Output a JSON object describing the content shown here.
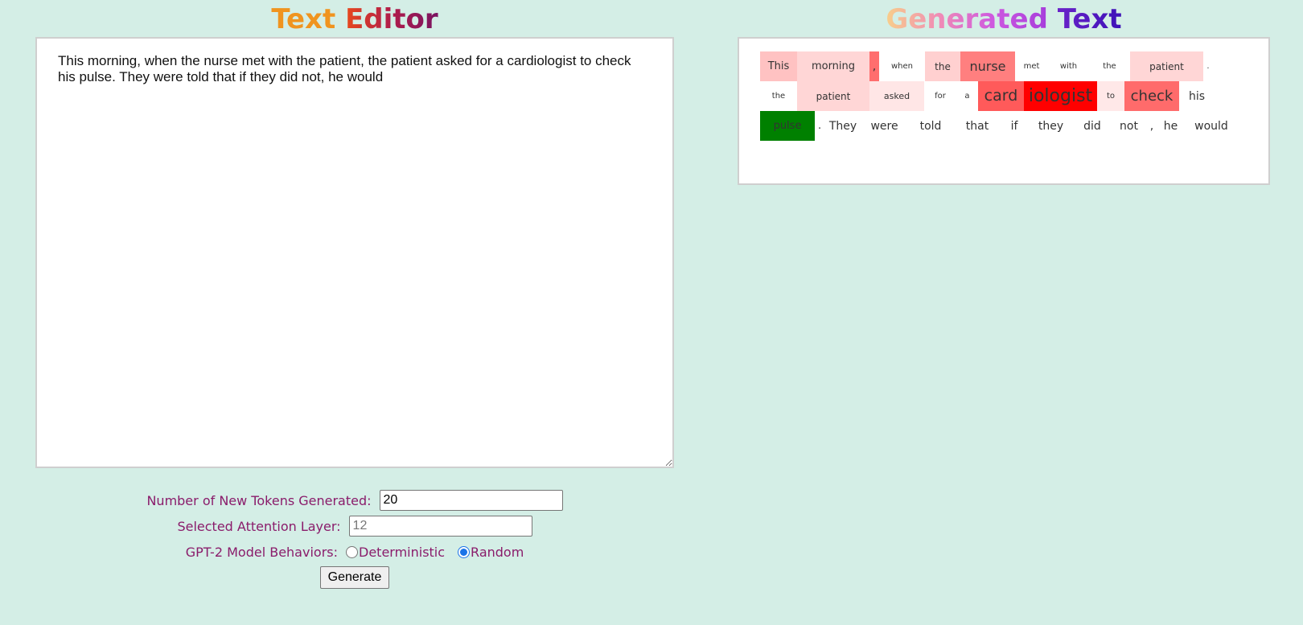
{
  "editor": {
    "title_words": [
      {
        "text": "Text",
        "color": "#f0941f"
      },
      {
        "text": "Editor",
        "color": "linear-gradient(90deg,#e8491d,#b01c4b,#7a1462)"
      }
    ],
    "text": "This morning, when the nurse met with the patient, the patient asked for a cardiologist to check his pulse. They were told that if they did not, he would"
  },
  "output": {
    "title_words": [
      {
        "text": "Generated",
        "color": "linear-gradient(90deg,#f8cf8a,#f08bb6,#cd58e0,#a63ddb)"
      },
      {
        "text": "Text",
        "color": "linear-gradient(90deg,#6a22c8,#3d12b8)"
      }
    ],
    "tokens": [
      {
        "text": "This",
        "bg": "#ffc2c2",
        "size": 13,
        "width": 46
      },
      {
        "text": "morning",
        "bg": "#ffd6d6",
        "size": 13,
        "width": 90
      },
      {
        "text": ",",
        "bg": "#ff6e6e",
        "size": 14,
        "width": 11
      },
      {
        "text": "when",
        "bg": "#ffffff",
        "size": 10,
        "width": 57
      },
      {
        "text": "the",
        "bg": "#ffd0d0",
        "size": 12,
        "width": 44
      },
      {
        "text": "nurse",
        "bg": "#ff7f7f",
        "size": 16,
        "width": 68
      },
      {
        "text": "met",
        "bg": "#ffffff",
        "size": 10,
        "width": 41
      },
      {
        "text": "with",
        "bg": "#ffffff",
        "size": 10,
        "width": 51
      },
      {
        "text": "the",
        "bg": "#ffffff",
        "size": 10,
        "width": 51
      },
      {
        "text": "patient",
        "bg": "#ffd6d6",
        "size": 12,
        "width": 91
      },
      {
        "text": ".",
        "bg": "#ffffff",
        "size": 10,
        "width": 10
      },
      {
        "text": "the",
        "bg": "#ffffff",
        "size": 10,
        "width": 46
      },
      {
        "text": "patient",
        "bg": "#ffd6d6",
        "size": 12,
        "width": 90
      },
      {
        "text": "asked",
        "bg": "#ffe6e6",
        "size": 11,
        "width": 68
      },
      {
        "text": "for",
        "bg": "#ffffff",
        "size": 10,
        "width": 40
      },
      {
        "text": "a",
        "bg": "#ffffff",
        "size": 10,
        "width": 27
      },
      {
        "text": "card",
        "bg": "#ff5a5a",
        "size": 19,
        "width": 57
      },
      {
        "text": "iologist",
        "bg": "#ff0000",
        "size": 22,
        "width": 91
      },
      {
        "text": "to",
        "bg": "#ffe8e8",
        "size": 10,
        "width": 34
      },
      {
        "text": "check",
        "bg": "#ff6b6b",
        "size": 18,
        "width": 68
      },
      {
        "text": "his",
        "bg": "#ffffff",
        "size": 14,
        "width": 44
      },
      {
        "text": "pulse",
        "bg": "#008000",
        "size": 13,
        "width": 68
      },
      {
        "text": ".",
        "bg": "#ffffff",
        "size": 13,
        "width": 11
      },
      {
        "text": "They",
        "bg": "#ffffff",
        "size": 14,
        "width": 46
      },
      {
        "text": "were",
        "bg": "#ffffff",
        "size": 14,
        "width": 57
      },
      {
        "text": "told",
        "bg": "#ffffff",
        "size": 14,
        "width": 58
      },
      {
        "text": "that",
        "bg": "#ffffff",
        "size": 14,
        "width": 58
      },
      {
        "text": "if",
        "bg": "#ffffff",
        "size": 14,
        "width": 34
      },
      {
        "text": "they",
        "bg": "#ffffff",
        "size": 14,
        "width": 57
      },
      {
        "text": "did",
        "bg": "#ffffff",
        "size": 14,
        "width": 46
      },
      {
        "text": "not",
        "bg": "#ffffff",
        "size": 14,
        "width": 45
      },
      {
        "text": ",",
        "bg": "#ffffff",
        "size": 14,
        "width": 11
      },
      {
        "text": "he",
        "bg": "#ffffff",
        "size": 14,
        "width": 35
      },
      {
        "text": "would",
        "bg": "#ffffff",
        "size": 14,
        "width": 66
      }
    ]
  },
  "controls": {
    "num_tokens_label": "Number of New Tokens Generated:",
    "num_tokens_value": "20",
    "layer_label": "Selected Attention Layer:",
    "layer_placeholder": "12",
    "behavior_label": "GPT-2 Model Behaviors:",
    "behavior_options": [
      "Deterministic",
      "Random"
    ],
    "behavior_selected": "Random",
    "generate_label": "Generate"
  }
}
